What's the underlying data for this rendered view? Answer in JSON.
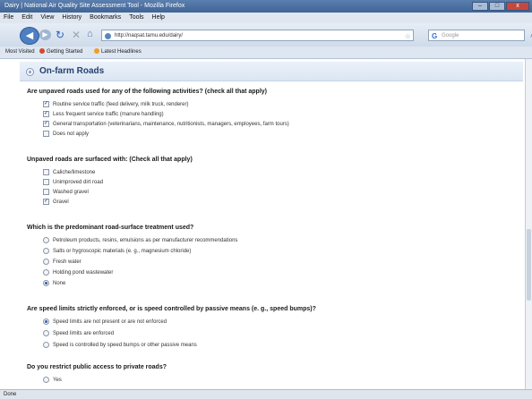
{
  "window": {
    "title": "Dairy | National Air Quality Site Assessment Tool - Mozilla Firefox",
    "controls": {
      "minimize": "–",
      "maximize": "□",
      "close": "x"
    }
  },
  "menu": [
    "File",
    "Edit",
    "View",
    "History",
    "Bookmarks",
    "Tools",
    "Help"
  ],
  "nav": {
    "url": "http://naqsat.tamu.edu/dairy/",
    "search_placeholder": "Google",
    "search_engine_letter": "G"
  },
  "bookmarks": [
    "Most Visited",
    "Getting Started",
    "Latest Headlines"
  ],
  "section": {
    "toggle": "+",
    "title": "On-farm Roads"
  },
  "questions": [
    {
      "text": "Are unpaved roads used for any of the following activities? (check all that apply)",
      "type": "checkbox",
      "options": [
        {
          "label": "Routine service traffic (feed delivery, milk truck, renderer)",
          "checked": true
        },
        {
          "label": "Less frequent service traffic (manure handling)",
          "checked": true
        },
        {
          "label": "General transportation (veterinarians, maintenance, nutritionists, managers, employees, farm tours)",
          "checked": true
        },
        {
          "label": "Does not apply",
          "checked": false
        }
      ]
    },
    {
      "text": "Unpaved roads are surfaced with: (Check all that apply)",
      "type": "checkbox",
      "options": [
        {
          "label": "Caliche/limestone",
          "checked": false
        },
        {
          "label": "Unimproved dirt road",
          "checked": false
        },
        {
          "label": "Washed gravel",
          "checked": false
        },
        {
          "label": "Gravel",
          "checked": true
        }
      ]
    },
    {
      "text": "Which is the predominant road-surface treatment used?",
      "type": "radio",
      "options": [
        {
          "label": "Petroleum products, resins, emulsions as per manufacturer recommendations",
          "checked": false
        },
        {
          "label": "Salts or hygroscopic materials (e. g., magnesium chloride)",
          "checked": false
        },
        {
          "label": "Fresh water",
          "checked": false
        },
        {
          "label": "Holding pond wastewater",
          "checked": false
        },
        {
          "label": "None",
          "checked": true
        }
      ]
    },
    {
      "text": "Are speed limits strictly enforced, or is speed controlled by passive means (e. g., speed bumps)?",
      "type": "radio",
      "options": [
        {
          "label": "Speed limits are not present or are not enforced",
          "checked": true
        },
        {
          "label": "Speed limits are enforced",
          "checked": false
        },
        {
          "label": "Speed is controlled by speed bumps or other passive means",
          "checked": false
        }
      ]
    },
    {
      "text": "Do you restrict public access to private roads?",
      "type": "radio",
      "options": [
        {
          "label": "Yes",
          "checked": false
        }
      ]
    }
  ],
  "status": "Done",
  "colors": {
    "accent": "#2d5fa8",
    "section_bg": "#dbe6f3",
    "titlebar": "#3f6496"
  }
}
